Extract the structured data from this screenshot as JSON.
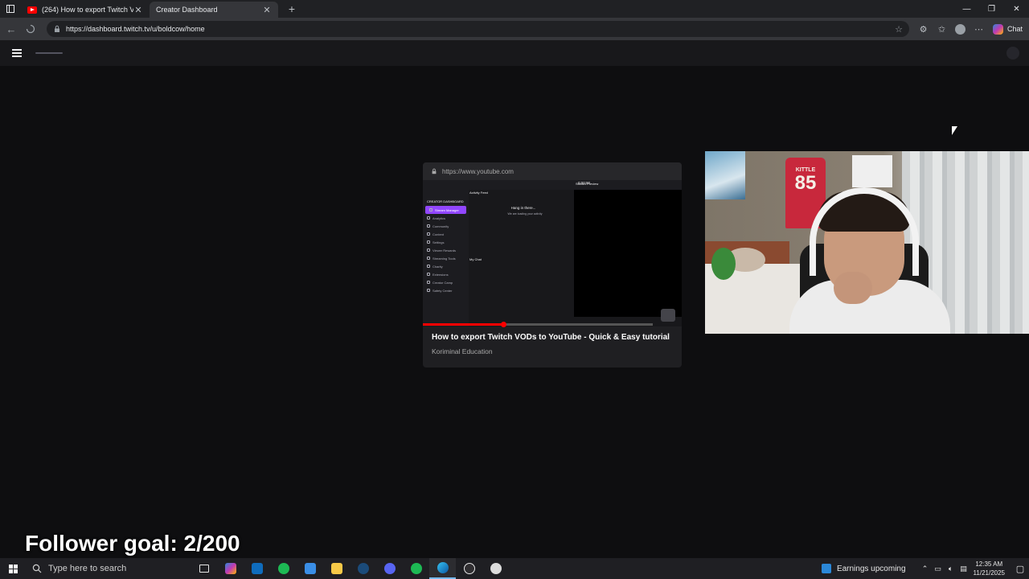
{
  "browser": {
    "tabs": [
      {
        "title": "(264) How to export Twitch V",
        "active": false
      },
      {
        "title": "Creator Dashboard",
        "active": true
      }
    ],
    "url": "https://dashboard.twitch.tv/u/boldcow/home",
    "chat_label": "Chat"
  },
  "miniplayer": {
    "url": "https://www.youtube.com",
    "video_title": "How to export Twitch VODs to YouTube - Quick & Easy tutorial",
    "channel": "Koriminal Education",
    "progress": 0.35,
    "inner_ui": {
      "sidebar_header": "CREATOR DASHBOARD",
      "sidebar_items": [
        "Stream Manager",
        "Analytics",
        "Community",
        "Content",
        "Settings",
        "Viewer Rewards",
        "Streaming Tools",
        "Charity",
        "Extensions",
        "Creator Camp",
        "Safety Center"
      ],
      "activity_feed_label": "Activity Feed",
      "loading_title": "Hang in there...",
      "loading_sub": "We are loading your activity",
      "stream_preview_label": "Stream Preview",
      "my_chat_label": "My Chat",
      "timer": "0:00:00"
    }
  },
  "webcam": {
    "jersey_name": "KITTLE",
    "jersey_number": "85"
  },
  "overlay": {
    "follower_goal": "Follower goal: 2/200"
  },
  "taskbar": {
    "search_placeholder": "Type here to search",
    "news": "Earnings upcoming",
    "time": "12:35 AM",
    "date": "11/21/2025",
    "apps": [
      "task-view",
      "copilot",
      "outlook",
      "spotify",
      "store",
      "file-explorer",
      "steam",
      "discord",
      "spotify-2",
      "edge",
      "obs",
      "other"
    ]
  },
  "colors": {
    "twitch_purple": "#9146ff",
    "youtube_red": "#ff0000",
    "page_bg": "#0e0e10"
  }
}
